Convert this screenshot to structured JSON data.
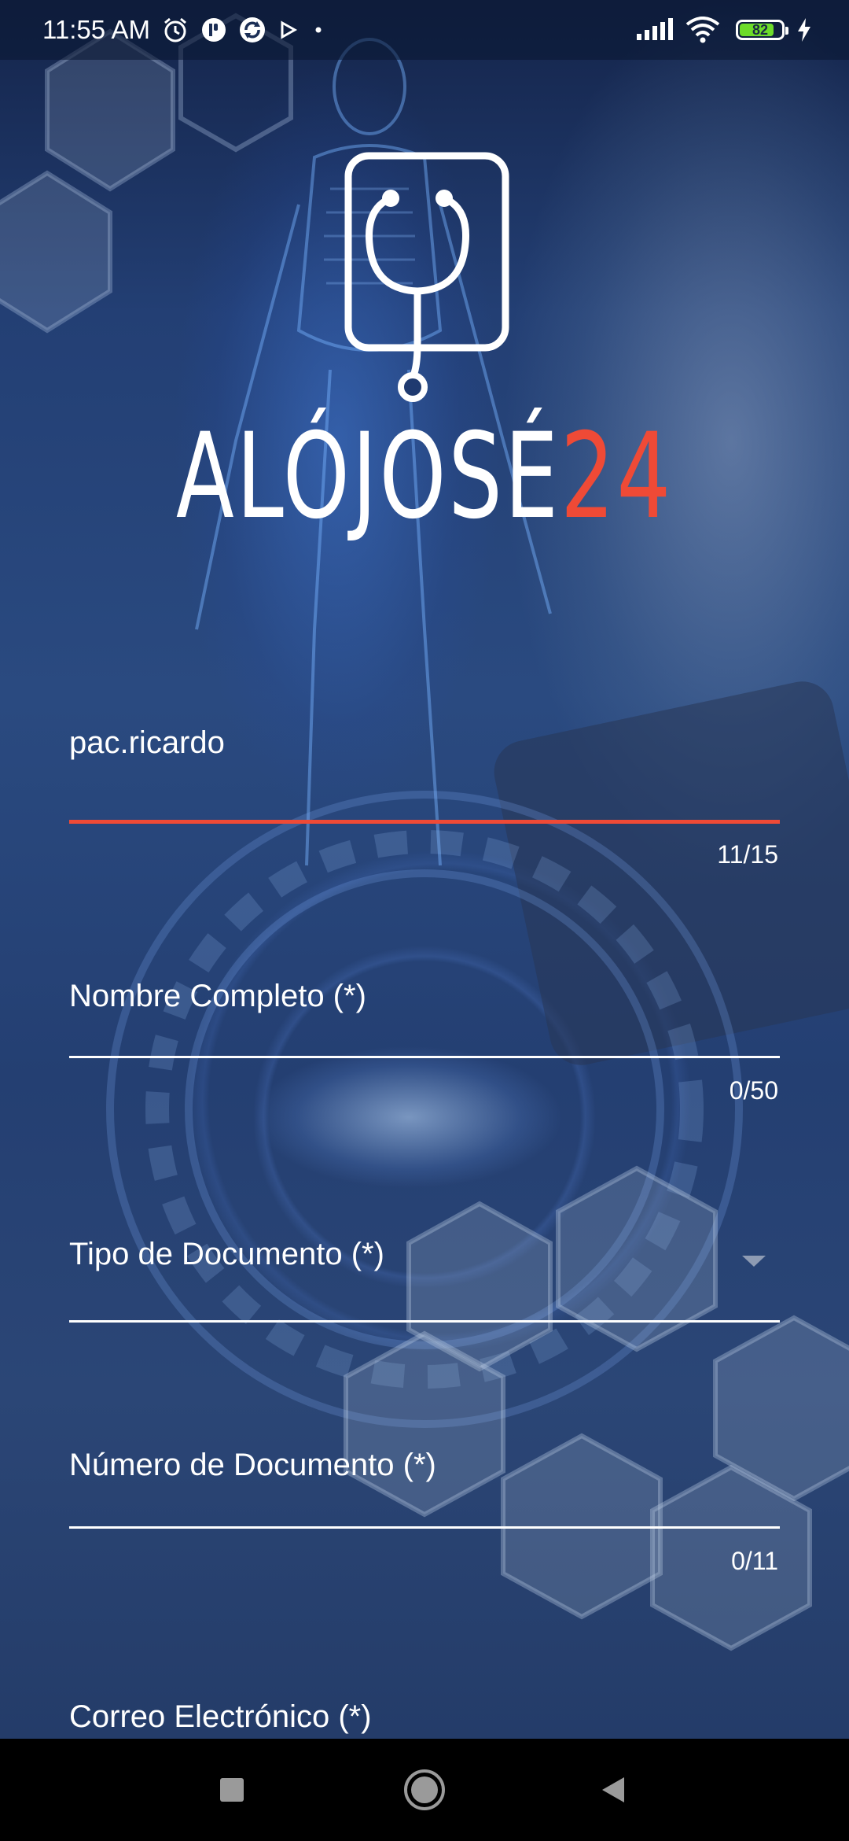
{
  "status_bar": {
    "time": "11:55 AM",
    "battery_level": "82",
    "battery_fraction": 0.82,
    "left_icons": [
      "alarm-icon",
      "app-notification-icon",
      "sync-notification-icon",
      "play-notification-icon",
      "dot-icon"
    ],
    "right_icons": [
      "signal-icon",
      "wifi-icon",
      "battery-icon",
      "charging-icon"
    ]
  },
  "logo": {
    "word_white": "ALÓJOSÉ",
    "word_red": "24",
    "icon": "stethoscope-phone-icon",
    "accent_color": "#ef4a36"
  },
  "form": {
    "username": {
      "value": "pac.ricardo",
      "counter": "11/15"
    },
    "full_name": {
      "label": "Nombre Completo (*)",
      "counter": "0/50"
    },
    "document_type": {
      "label": "Tipo de Documento (*)"
    },
    "document_number": {
      "label": "Número de Documento (*)",
      "counter": "0/11"
    },
    "email": {
      "label": "Correo Electrónico (*)"
    }
  },
  "nav_bar": {
    "buttons": [
      "recents-square-icon",
      "home-circle-icon",
      "back-triangle-icon"
    ]
  }
}
